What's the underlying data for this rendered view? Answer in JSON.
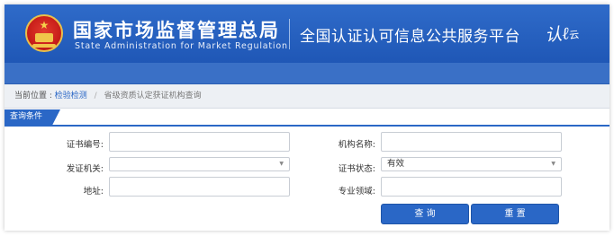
{
  "header": {
    "org_name_cn": "国家市场监督管理总局",
    "org_name_en": "State Administration  for  Market Regulation",
    "platform_title": "全国认证认可信息公共服务平台",
    "logo_text": "认",
    "logo_sub": "云"
  },
  "breadcrumb": {
    "prefix": "当前位置 :",
    "link": "检验检测",
    "separator": "/",
    "current": "省级资质认定获证机构查询"
  },
  "query": {
    "tab_label": "查询条件",
    "fields": {
      "cert_number": {
        "label": "证书编号:",
        "value": ""
      },
      "org_name": {
        "label": "机构名称:",
        "value": ""
      },
      "issuing_authority": {
        "label": "发证机关:",
        "value": ""
      },
      "cert_status": {
        "label": "证书状态:",
        "value": "有效"
      },
      "address": {
        "label": "地址:",
        "value": ""
      },
      "professional_field": {
        "label": "专业领域:",
        "value": ""
      }
    },
    "buttons": {
      "search": "查 询",
      "reset": "重 置"
    }
  },
  "colors": {
    "banner": "#2f6bc9",
    "accent": "#2a67c6",
    "breadcrumb_bg": "#edf0f4"
  }
}
